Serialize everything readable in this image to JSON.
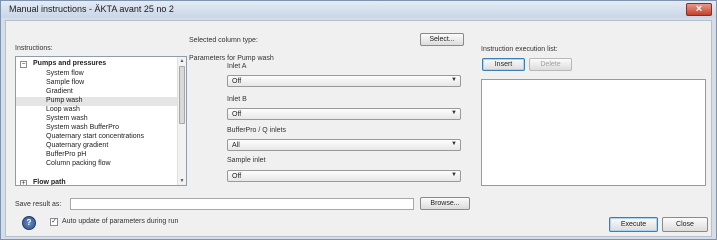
{
  "window": {
    "title": "Manual instructions - ÄKTA avant 25  no 2"
  },
  "instructions": {
    "label": "Instructions:",
    "group": "Pumps and pressures",
    "items": [
      "System flow",
      "Sample flow",
      "Gradient",
      "Pump wash",
      "Loop wash",
      "System wash",
      "System wash BufferPro",
      "Quaternary start concentrations",
      "Quaternary gradient",
      "BufferPro pH",
      "Column packing flow"
    ],
    "selected": "Pump wash",
    "next_group_partial": "Flow path"
  },
  "column": {
    "label": "Selected column type:",
    "select_button": "Select..."
  },
  "parameters": {
    "title": "Parameters for Pump wash",
    "fields": [
      {
        "label": "Inlet A",
        "value": "Off"
      },
      {
        "label": "Inlet B",
        "value": "Off"
      },
      {
        "label": "BufferPro / Q inlets",
        "value": "All"
      },
      {
        "label": "Sample inlet",
        "value": "Off"
      }
    ]
  },
  "execution": {
    "label": "Instruction execution list:",
    "insert_button": "Insert",
    "delete_button": "Delete"
  },
  "save": {
    "label": "Save result as:",
    "value": "",
    "browse_button": "Browse..."
  },
  "footer": {
    "help_icon": "?",
    "auto_update_label": "Auto update of parameters during run",
    "auto_update_checked": "✓",
    "execute_button": "Execute",
    "close_button": "Close"
  }
}
